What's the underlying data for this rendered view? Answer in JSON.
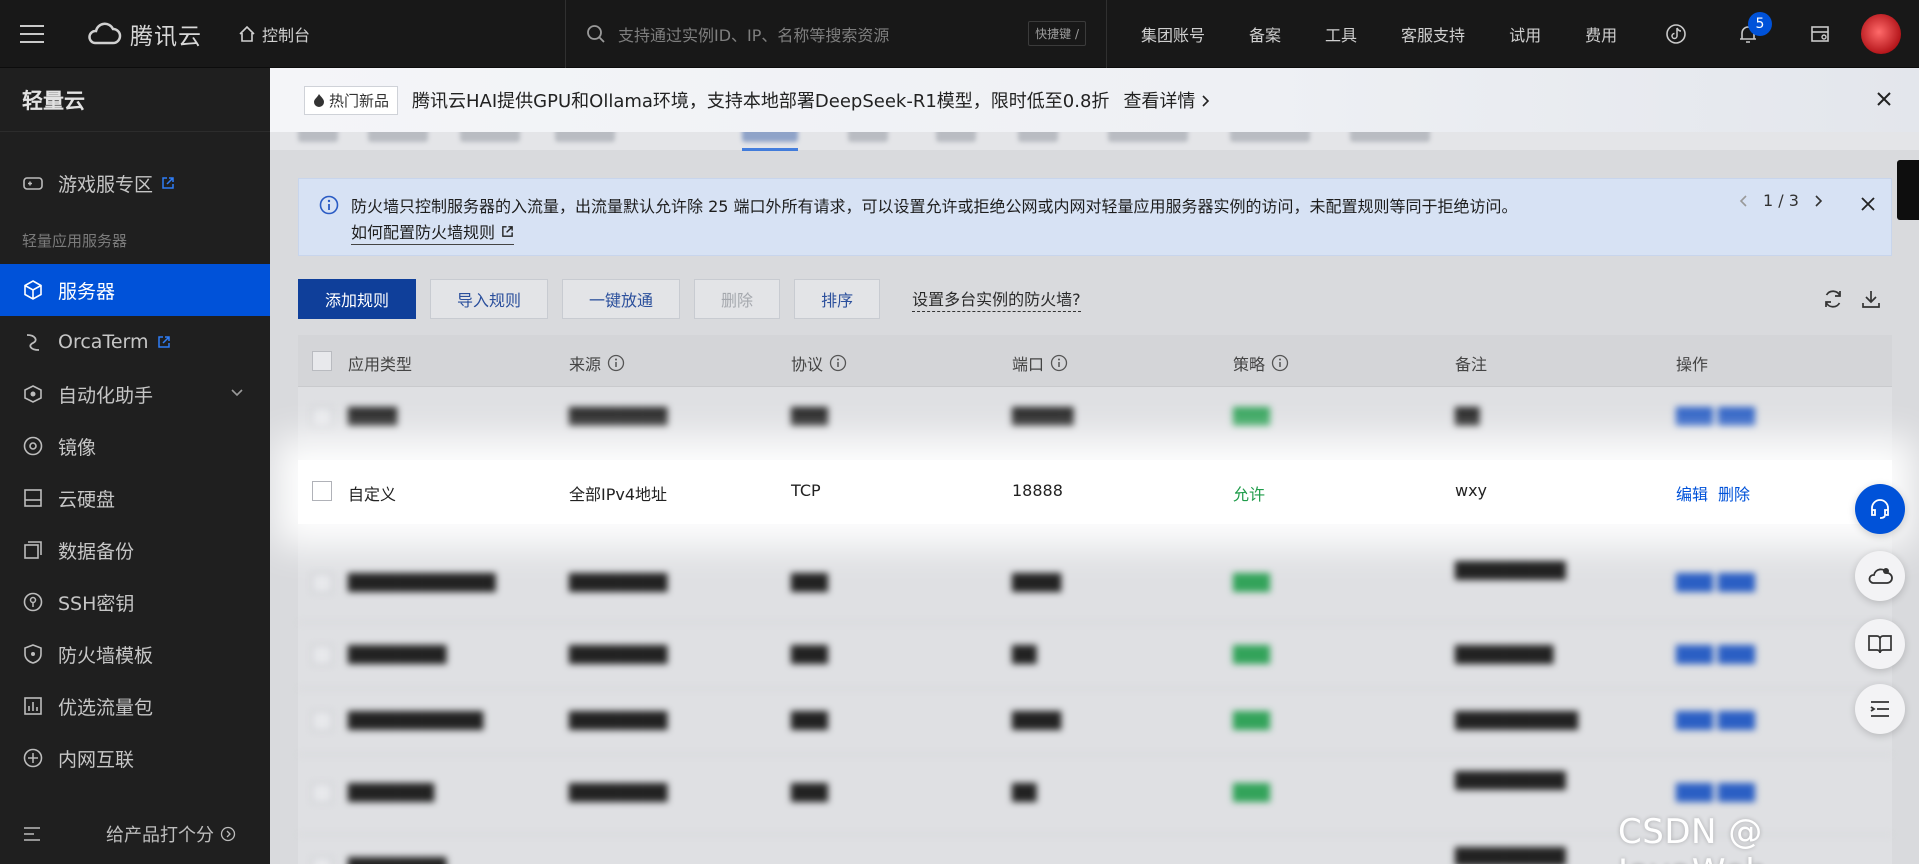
{
  "topbar": {
    "brand": "腾讯云",
    "console": "控制台",
    "search_placeholder": "支持通过实例ID、IP、名称等搜索资源",
    "shortcut": "快捷键 /",
    "links": [
      "集团账号",
      "备案",
      "工具",
      "客服支持",
      "试用",
      "费用"
    ],
    "notification_count": "5"
  },
  "sidebar": {
    "title": "轻量云",
    "items": [
      {
        "label": "游戏服专区",
        "icon": "gamepad-icon"
      },
      {
        "label": "服务器",
        "icon": "cube-icon"
      },
      {
        "label": "OrcaTerm",
        "icon": "terminal-icon"
      },
      {
        "label": "自动化助手",
        "icon": "robot-icon"
      },
      {
        "label": "镜像",
        "icon": "disc-icon"
      },
      {
        "label": "云硬盘",
        "icon": "disk-icon"
      },
      {
        "label": "数据备份",
        "icon": "backup-icon"
      },
      {
        "label": "SSH密钥",
        "icon": "key-icon"
      },
      {
        "label": "防火墙模板",
        "icon": "shield-icon"
      },
      {
        "label": "优选流量包",
        "icon": "chart-icon"
      },
      {
        "label": "内网互联",
        "icon": "link-icon"
      }
    ],
    "group_label": "轻量应用服务器",
    "footer_rate": "给产品打个分"
  },
  "promo": {
    "tag": "热门新品",
    "text": "腾讯云HAI提供GPU和Ollama环境，支持本地部署DeepSeek-R1模型，限时低至0.8折",
    "link": "查看详情"
  },
  "notice": {
    "text": "防火墙只控制服务器的入流量，出流量默认允许除 25 端口外所有请求，可以设置允许或拒绝公网或内网对轻量应用服务器实例的访问，未配置规则等同于拒绝访问。",
    "link": "如何配置防火墙规则",
    "pager": "1 / 3"
  },
  "toolbar": {
    "add": "添加规则",
    "import": "导入规则",
    "open_all": "一键放通",
    "delete": "删除",
    "sort": "排序",
    "multi": "设置多台实例的防火墙?"
  },
  "table": {
    "headers": [
      "应用类型",
      "来源",
      "协议",
      "端口",
      "策略",
      "备注",
      "操作"
    ],
    "highlight_row": {
      "type": "自定义",
      "source": "全部IPv4地址",
      "protocol": "TCP",
      "port": "18888",
      "policy": "允许",
      "note": "wxy",
      "edit": "编辑",
      "delete": "删除"
    }
  },
  "watermark": "CSDN @ JavaWeb"
}
